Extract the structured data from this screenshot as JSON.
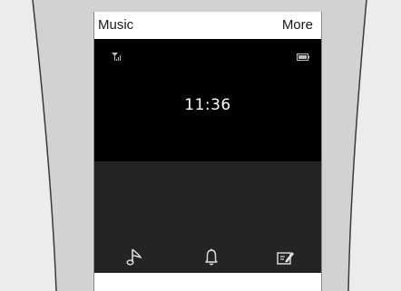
{
  "softkeys": {
    "left_label": "Music",
    "right_label": "More"
  },
  "status_bar": {
    "signal_icon": "signal-icon",
    "battery_icon": "battery-icon"
  },
  "idle_screen": {
    "time": "11:36"
  },
  "shortcuts": [
    {
      "icon": "music-note-icon"
    },
    {
      "icon": "bell-icon"
    },
    {
      "icon": "memo-icon"
    }
  ],
  "colors": {
    "screen": "#000000",
    "shortcut_panel": "#242424",
    "bezel": "#d2d2d2"
  }
}
